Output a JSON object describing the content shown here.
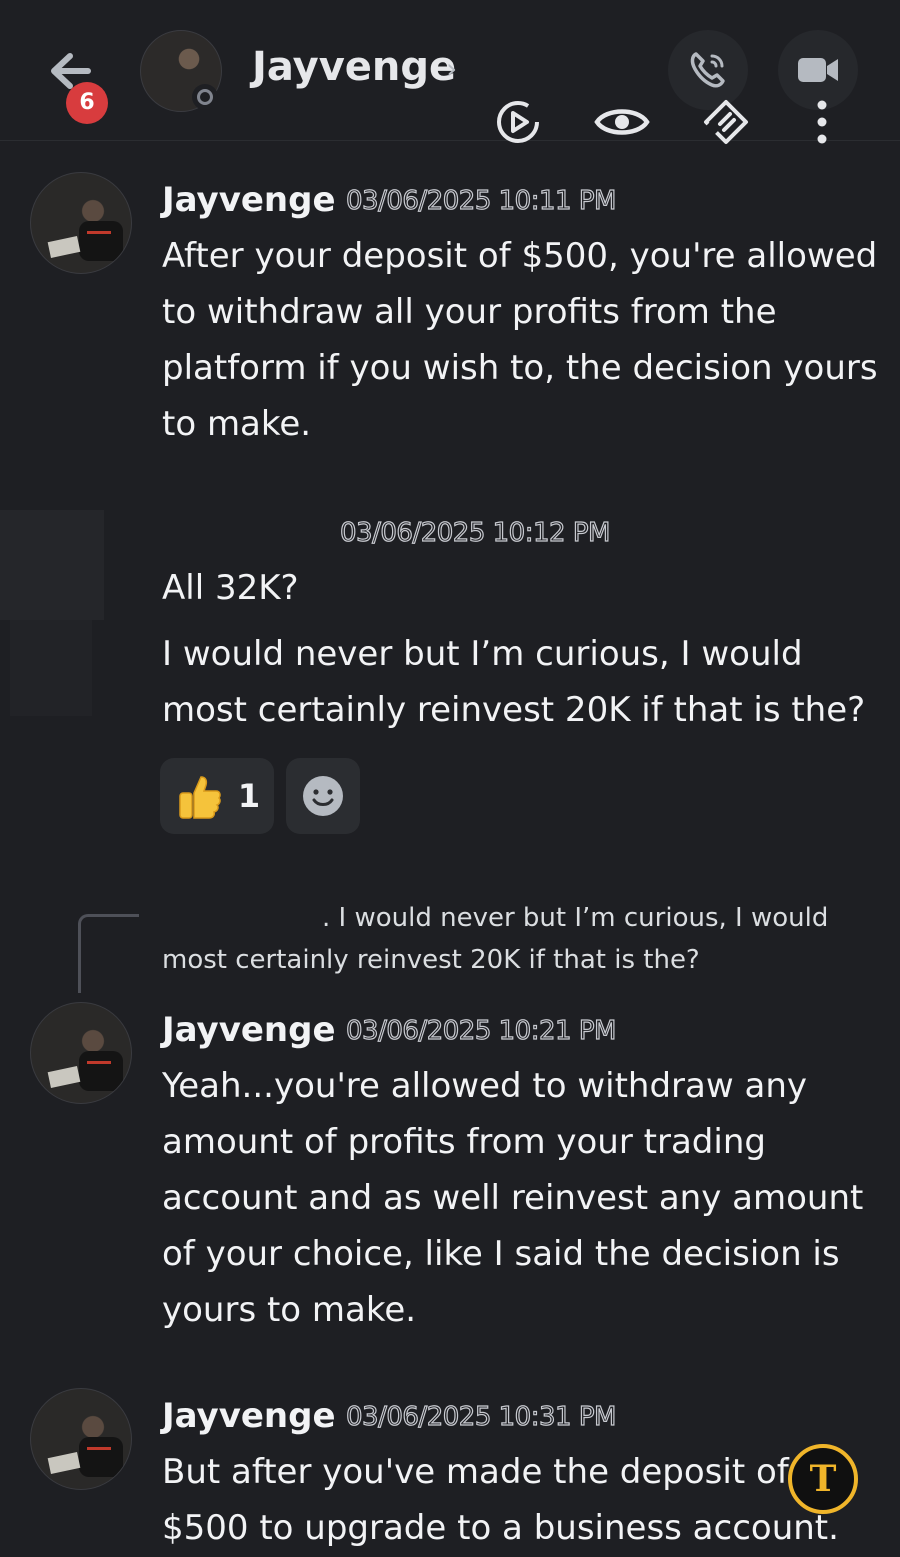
{
  "header": {
    "badge_count": "6",
    "contact_name": "Jayvenge",
    "chevron": "›",
    "icons": [
      "back-arrow-icon",
      "phone-icon",
      "video-camera-icon",
      "activity-icon",
      "eye-icon",
      "nitro-icon",
      "more-vertical-icon"
    ]
  },
  "messages": [
    {
      "author": "Jayvenge",
      "timestamp": "03/06/2025 10:11 PM",
      "text": "After your deposit of $500, you're allowed to withdraw all your profits from the platform if you wish to, the decision yours to make."
    },
    {
      "author": "",
      "timestamp": "03/06/2025 10:12 PM",
      "lines": [
        "All 32K?",
        "I would never but I’m curious, I would most certainly reinvest 20K if that is the?"
      ],
      "reactions": [
        {
          "emoji": "👍",
          "count": "1"
        },
        {
          "emoji": "add-reaction-icon",
          "count": ""
        }
      ]
    },
    {
      "reply_to": ". I would never but I’m curious, I would most certainly reinvest 20K if that is the?",
      "author": "Jayvenge",
      "timestamp": "03/06/2025 10:21 PM",
      "text": "Yeah...you're allowed to withdraw any amount of profits from your trading account and as well reinvest any amount of your choice, like I said the decision is yours to make."
    },
    {
      "author": "Jayvenge",
      "timestamp": "03/06/2025 10:31 PM",
      "text": "But after you've made the deposit of $500 to upgrade to a business account."
    }
  ],
  "fab": {
    "label": "T"
  },
  "colors": {
    "background": "#1e1f23",
    "badge": "#d83c3e",
    "fab_ring": "#f0b52a"
  }
}
